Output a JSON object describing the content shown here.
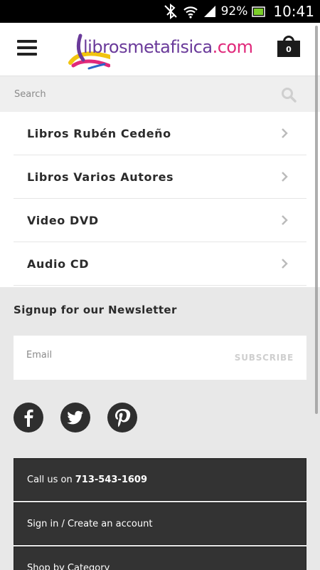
{
  "status_bar": {
    "battery_percent": "92%",
    "time": "10:41"
  },
  "header": {
    "logo_part1": "librosmetafisica",
    "logo_part2": ".com",
    "cart_count": "0"
  },
  "search": {
    "placeholder": "Search"
  },
  "menu": {
    "items": [
      {
        "label": "Libros Rubén Cedeño"
      },
      {
        "label": "Libros Varios Autores"
      },
      {
        "label": "Video DVD"
      },
      {
        "label": "Audio CD"
      }
    ]
  },
  "newsletter": {
    "title": "Signup for our Newsletter",
    "email_placeholder": "Email",
    "subscribe_label": "SUBSCRIBE"
  },
  "social": {
    "icons": [
      "facebook-icon",
      "twitter-icon",
      "pinterest-icon"
    ]
  },
  "footer": {
    "call_prefix": "Call us on",
    "phone": "713-543-1609",
    "account_label": "Sign in / Create an account",
    "shop_label": "Shop by Category"
  },
  "colors": {
    "logo_purple": "#6a3a9a",
    "logo_pink": "#e0287a",
    "footer_dark": "#333333",
    "page_bg": "#e8e8e8"
  }
}
